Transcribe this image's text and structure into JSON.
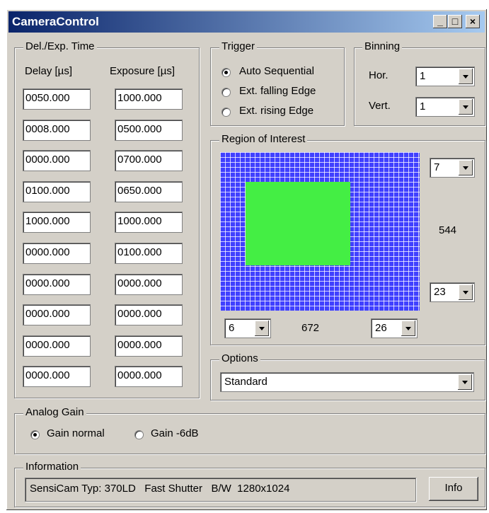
{
  "window": {
    "title": "CameraControl",
    "minimize": "_",
    "maximize": "□",
    "close": "×"
  },
  "delay_exposure": {
    "group_label": "Del./Exp. Time",
    "delay_header": "Delay [µs]",
    "exposure_header": "Exposure [µs]",
    "rows": [
      {
        "delay": "0050.000",
        "exposure": "1000.000"
      },
      {
        "delay": "0008.000",
        "exposure": "0500.000"
      },
      {
        "delay": "0000.000",
        "exposure": "0700.000"
      },
      {
        "delay": "0100.000",
        "exposure": "0650.000"
      },
      {
        "delay": "1000.000",
        "exposure": "1000.000"
      },
      {
        "delay": "0000.000",
        "exposure": "0100.000"
      },
      {
        "delay": "0000.000",
        "exposure": "0000.000"
      },
      {
        "delay": "0000.000",
        "exposure": "0000.000"
      },
      {
        "delay": "0000.000",
        "exposure": "0000.000"
      },
      {
        "delay": "0000.000",
        "exposure": "0000.000"
      }
    ]
  },
  "trigger": {
    "group_label": "Trigger",
    "options": [
      "Auto Sequential",
      "Ext. falling Edge",
      "Ext. rising Edge"
    ],
    "selected": 0
  },
  "binning": {
    "group_label": "Binning",
    "hor_label": "Hor.",
    "hor_value": "1",
    "vert_label": "Vert.",
    "vert_value": "1"
  },
  "roi": {
    "group_label": "Region of Interest",
    "top_value": "7",
    "height_readout": "544",
    "bottom_value": "23",
    "left_value": "6",
    "width_readout": "672",
    "right_value": "26",
    "grid_color": "#4040ff",
    "selection_color": "#44ee44"
  },
  "options": {
    "group_label": "Options",
    "value": "Standard"
  },
  "analog_gain": {
    "group_label": "Analog Gain",
    "options": [
      "Gain normal",
      "Gain -6dB"
    ],
    "selected": 0
  },
  "information": {
    "group_label": "Information",
    "text": "SensiCam Typ: 370LD   Fast Shutter   B/W  1280x1024",
    "button_label": "Info"
  }
}
